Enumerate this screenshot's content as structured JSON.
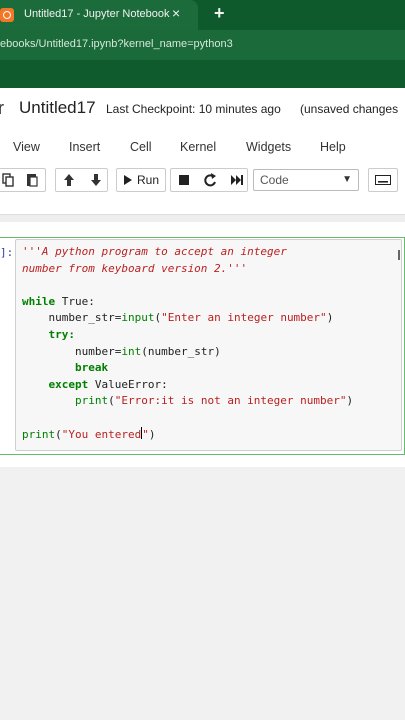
{
  "browser": {
    "tab_title": "Untitled17 - Jupyter Notebook",
    "tab_close": "×",
    "new_tab": "+",
    "url": "ebooks/Untitled17.ipynb?kernel_name=python3"
  },
  "header": {
    "logo_fragment": "r",
    "title": "Untitled17",
    "checkpoint": "Last Checkpoint: 10 minutes ago",
    "unsaved": "(unsaved changes"
  },
  "menu": {
    "items": [
      "View",
      "Insert",
      "Cell",
      "Kernel",
      "Widgets",
      "Help"
    ]
  },
  "toolbar": {
    "run_label": "Run",
    "cell_type": "Code",
    "icons": [
      "copy-icon",
      "paste-icon",
      "move-up-icon",
      "move-down-icon",
      "run-icon",
      "stop-icon",
      "restart-icon",
      "fast-forward-icon",
      "chevron-down-icon",
      "keyboard-icon"
    ]
  },
  "cell": {
    "prompt": "]:",
    "lines": {
      "l1": "'''A python program to accept an integer",
      "l2": "number from keyboard version 2.'''",
      "l4_kw": "while",
      "l4_rest": " True:",
      "l5_var": "number_str",
      "l5_eq": "=",
      "l5_fn": "input",
      "l5_str": "\"Enter an integer number\"",
      "l6_kw": "try:",
      "l7_var": "number",
      "l7_eq": "=",
      "l7_fn": "int",
      "l7_arg": "number_str",
      "l8_kw": "break",
      "l9_kw": "except",
      "l9_rest": " ValueError:",
      "l10_fn": "print",
      "l10_str": "\"Error:it is not an integer number\"",
      "l12_fn": "print",
      "l12_str_a": "\"You entered",
      "l12_str_b": "\""
    }
  },
  "colors": {
    "tab_bar": "#0e5a2c",
    "cell_border": "#4caf50",
    "keyword": "#008000",
    "string": "#ba2121"
  }
}
